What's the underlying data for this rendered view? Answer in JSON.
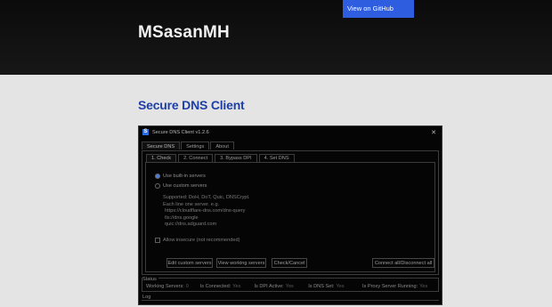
{
  "header": {
    "github_button": "View on GitHub",
    "site_title": "MSasanMH"
  },
  "page": {
    "title": "Secure DNS Client"
  },
  "app": {
    "window_title": "Secure DNS Client v1.2.6",
    "main_tabs": [
      "Secure DNS",
      "Settings",
      "About"
    ],
    "sub_tabs": [
      "1. Check",
      "2. Connect",
      "3. Bypass DPI",
      "4. Set DNS"
    ],
    "radio_builtin": "Use built-in servers",
    "radio_custom": "Use custom servers",
    "help_lines": [
      "Supported: DoH, DoT, Quic, DNSCrypt.",
      "Each line one server. e.g.",
      "https://cloudflare-dns.com/dns-query",
      "tls://dns.google",
      "quic://dns.adguard.com"
    ],
    "allow_insecure": "Allow insecure (not recommended)",
    "buttons": {
      "edit_custom": "Edit custom servers",
      "view_working": "View working servers",
      "check_cancel": "Check/Cancel",
      "connect_all": "Connect all/Disconnect all"
    },
    "status": {
      "label": "Status",
      "items": [
        {
          "label": "Working Servers:",
          "value": "0"
        },
        {
          "label": "Is Connected:",
          "value": "Yes"
        },
        {
          "label": "Is DPI Active:",
          "value": "Yes"
        },
        {
          "label": "Is DNS Set:",
          "value": "Yes"
        },
        {
          "label": "Is Proxy Server Running:",
          "value": "Yes"
        }
      ]
    },
    "log_label": "Log"
  }
}
